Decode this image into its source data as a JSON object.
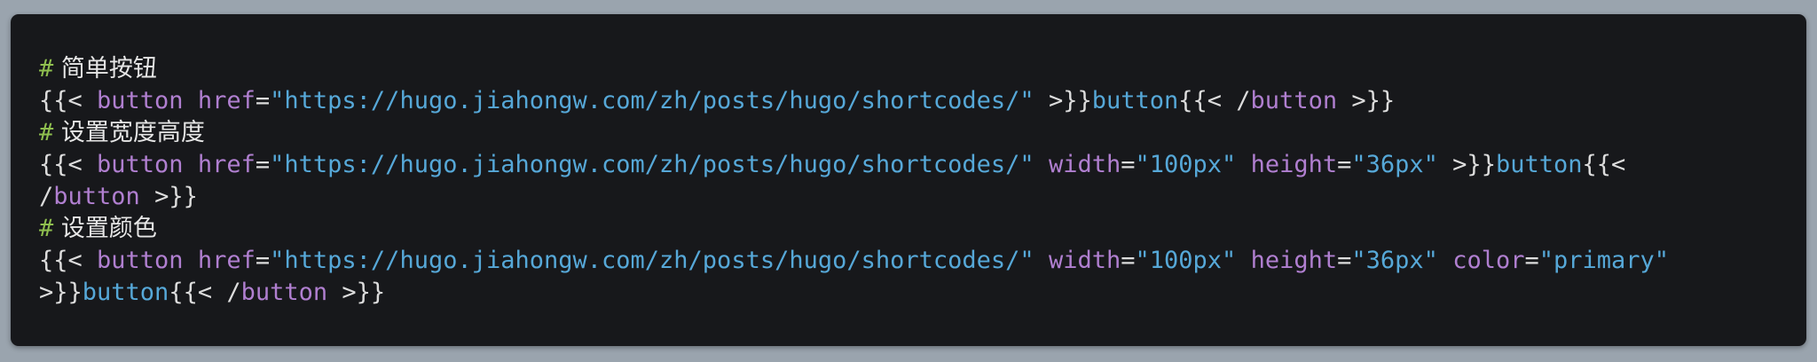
{
  "colors": {
    "background": "#9aa4ae",
    "code_bg": "#17181b",
    "comment_mark": "#8fbf4f",
    "comment_text": "#e6e6e6",
    "punct": "#dcdcdc",
    "keyword": "#b07fd0",
    "string": "#56a8d8"
  },
  "code": {
    "c1_mark": "#",
    "c1_text": " 简单按钮",
    "c2_mark": "#",
    "c2_text": " 设置宽度高度",
    "c3_mark": "#",
    "c3_text": " 设置颜色",
    "open": "{{< ",
    "open_tight": "{{<",
    "close": " >}}",
    "close_tight": ">}}",
    "close_open": "{{< /",
    "slash": "/",
    "button": "button",
    "space": " ",
    "href": "href",
    "width": "width",
    "height": "height",
    "color": "color",
    "eq": "=",
    "url": "\"https://hugo.jiahongw.com/zh/posts/hugo/shortcodes/\"",
    "width_val": "\"100px\"",
    "height_val": "\"36px\"",
    "color_val": "\"primary\"",
    "inner_text": "button"
  }
}
